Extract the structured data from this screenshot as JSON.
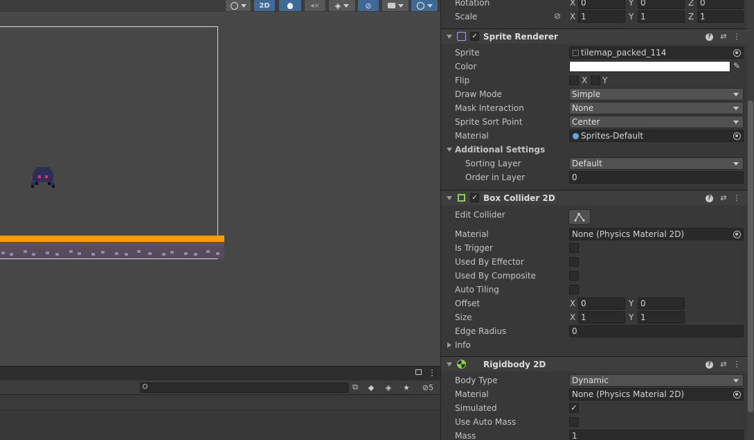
{
  "scene": {
    "toolbar": {
      "mode_2d": "2D"
    }
  },
  "bottom_panel": {
    "search_placeholder": "",
    "hidden_count": "5"
  },
  "inspector": {
    "transform": {
      "rotation_label": "Rotation",
      "rotation": {
        "x": "0",
        "y": "0",
        "z": "0"
      },
      "scale_label": "Scale",
      "scale": {
        "x": "1",
        "y": "1",
        "z": "1"
      }
    },
    "sprite_renderer": {
      "title": "Sprite Renderer",
      "sprite_label": "Sprite",
      "sprite_value": "tilemap_packed_114",
      "color_label": "Color",
      "color_value": "#ffffff",
      "flip_label": "Flip",
      "flip_x": "X",
      "flip_y": "Y",
      "draw_mode_label": "Draw Mode",
      "draw_mode_value": "Simple",
      "mask_label": "Mask Interaction",
      "mask_value": "None",
      "sort_point_label": "Sprite Sort Point",
      "sort_point_value": "Center",
      "material_label": "Material",
      "material_value": "Sprites-Default",
      "additional_settings": "Additional Settings",
      "sorting_layer_label": "Sorting Layer",
      "sorting_layer_value": "Default",
      "order_label": "Order in Layer",
      "order_value": "0"
    },
    "box_collider": {
      "title": "Box Collider 2D",
      "edit_collider_label": "Edit Collider",
      "material_label": "Material",
      "material_value": "None (Physics Material 2D)",
      "is_trigger_label": "Is Trigger",
      "used_by_effector_label": "Used By Effector",
      "used_by_composite_label": "Used By Composite",
      "auto_tiling_label": "Auto Tiling",
      "offset_label": "Offset",
      "offset": {
        "x": "0",
        "y": "0"
      },
      "size_label": "Size",
      "size": {
        "x": "1",
        "y": "1"
      },
      "edge_radius_label": "Edge Radius",
      "edge_radius_value": "0",
      "info_label": "Info"
    },
    "rigidbody": {
      "title": "Rigidbody 2D",
      "body_type_label": "Body Type",
      "body_type_value": "Dynamic",
      "material_label": "Material",
      "material_value": "None (Physics Material 2D)",
      "simulated_label": "Simulated",
      "auto_mass_label": "Use Auto Mass",
      "mass_label": "Mass",
      "mass_value": "1"
    },
    "axis": {
      "x": "X",
      "y": "Y",
      "z": "Z"
    }
  },
  "colors": {
    "ground_top": "#ff9c00",
    "active_button": "#3f6a95",
    "collider_icon": "#8fd14f"
  }
}
